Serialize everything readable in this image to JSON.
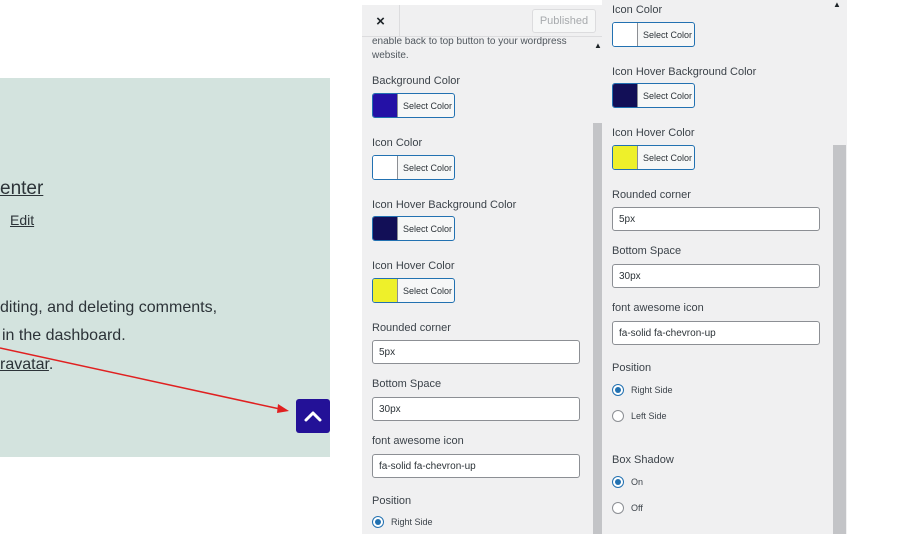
{
  "preview": {
    "title_fragment": "enter",
    "edit_label": "Edit",
    "para_line1": "diting, and deleting comments,",
    "para_line2": "in the dashboard.",
    "para_line3_link": "ravatar",
    "para_line3_end": "."
  },
  "panel1": {
    "close_label": "×",
    "publish_label": "Published",
    "description": "enable back to top button to your wordpress website.",
    "fields": {
      "background_color_label": "Background Color",
      "icon_color_label": "Icon Color",
      "icon_hover_bg_label": "Icon Hover Background Color",
      "icon_hover_color_label": "Icon Hover Color",
      "select_color": "Select Color",
      "rounded_corner_label": "Rounded corner",
      "rounded_corner_value": "5px",
      "bottom_space_label": "Bottom Space",
      "bottom_space_value": "30px",
      "font_awesome_label": "font awesome icon",
      "font_awesome_value": "fa-solid fa-chevron-up",
      "position_label": "Position",
      "right_side": "Right Side"
    }
  },
  "panel2": {
    "icon_color_label": "Icon Color",
    "icon_hover_bg_label": "Icon Hover Background Color",
    "icon_hover_color_label": "Icon Hover Color",
    "select_color": "Select Color",
    "rounded_corner_label": "Rounded corner",
    "rounded_corner_value": "5px",
    "bottom_space_label": "Bottom Space",
    "bottom_space_value": "30px",
    "font_awesome_label": "font awesome icon",
    "font_awesome_value": "fa-solid fa-chevron-up",
    "position_label": "Position",
    "right_side": "Right Side",
    "left_side": "Left Side",
    "box_shadow_label": "Box Shadow",
    "on_label": "On",
    "off_label": "Off"
  },
  "colors": {
    "background_color": "#2411a6",
    "icon_color": "#ffffff",
    "icon_hover_bg": "#120f57",
    "icon_hover_color": "#eef02a",
    "accent": "#2271b1",
    "preview_bg": "#d3e3de",
    "backtop_bg": "#231197",
    "arrow": "#e02020"
  }
}
